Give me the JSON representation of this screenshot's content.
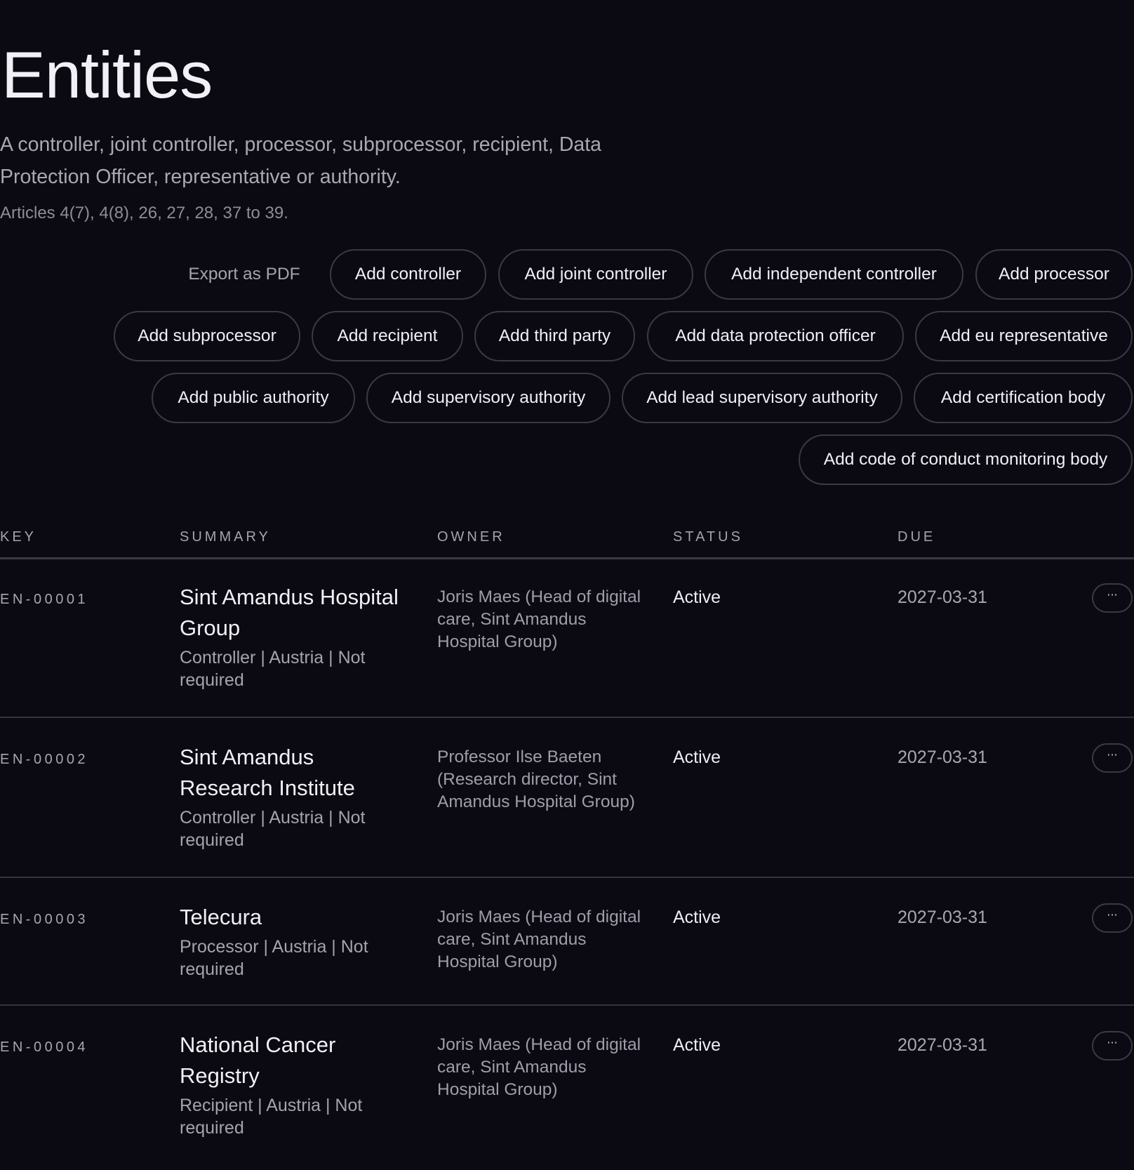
{
  "page": {
    "title": "Entities",
    "description": "A controller, joint controller, processor, subprocessor, recipient, Data Protection Officer, representative or authority.",
    "articles": "Articles 4(7), 4(8), 26, 27, 28, 37 to 39."
  },
  "actions": {
    "export_pdf": "Export as PDF",
    "add_controller": "Add controller",
    "add_joint_controller": "Add joint controller",
    "add_independent_controller": "Add independent controller",
    "add_processor": "Add processor",
    "add_subprocessor": "Add subprocessor",
    "add_recipient": "Add recipient",
    "add_third_party": "Add third party",
    "add_data_protection_officer": "Add data protection officer",
    "add_eu_representative": "Add eu representative",
    "add_public_authority": "Add public authority",
    "add_supervisory_authority": "Add supervisory authority",
    "add_lead_supervisory_authority": "Add lead supervisory authority",
    "add_certification_body": "Add certification body",
    "add_code_of_conduct_monitoring_body": "Add code of conduct monitoring body"
  },
  "table": {
    "headers": {
      "key": "KEY",
      "summary": "SUMMARY",
      "owner": "OWNER",
      "status": "STATUS",
      "due": "DUE"
    },
    "rows": [
      {
        "key": "EN-00001",
        "name": "Sint Amandus Hospital Group",
        "meta": "Controller | Austria | Not required",
        "owner": "Joris Maes (Head of digital care, Sint Amandus Hospital Group)",
        "status": "Active",
        "due": "2027-03-31",
        "menu": "···"
      },
      {
        "key": "EN-00002",
        "name": "Sint Amandus Research Institute",
        "meta": "Controller | Austria | Not required",
        "owner": "Professor Ilse Baeten (Research director, Sint Amandus Hospital Group)",
        "status": "Active",
        "due": "2027-03-31",
        "menu": "···"
      },
      {
        "key": "EN-00003",
        "name": "Telecura",
        "meta": "Processor | Austria | Not required",
        "owner": "Joris Maes (Head of digital care, Sint Amandus Hospital Group)",
        "status": "Active",
        "due": "2027-03-31",
        "menu": "···"
      },
      {
        "key": "EN-00004",
        "name": "National Cancer Registry",
        "meta": "Recipient | Austria | Not required",
        "owner": "Joris Maes (Head of digital care, Sint Amandus Hospital Group)",
        "status": "Active",
        "due": "2027-03-31",
        "menu": "···"
      }
    ]
  },
  "colors": {
    "background": "#0b0a12",
    "text_primary": "#f1f0f6",
    "text_secondary": "#a5a3ae",
    "border": "#3a3944"
  }
}
